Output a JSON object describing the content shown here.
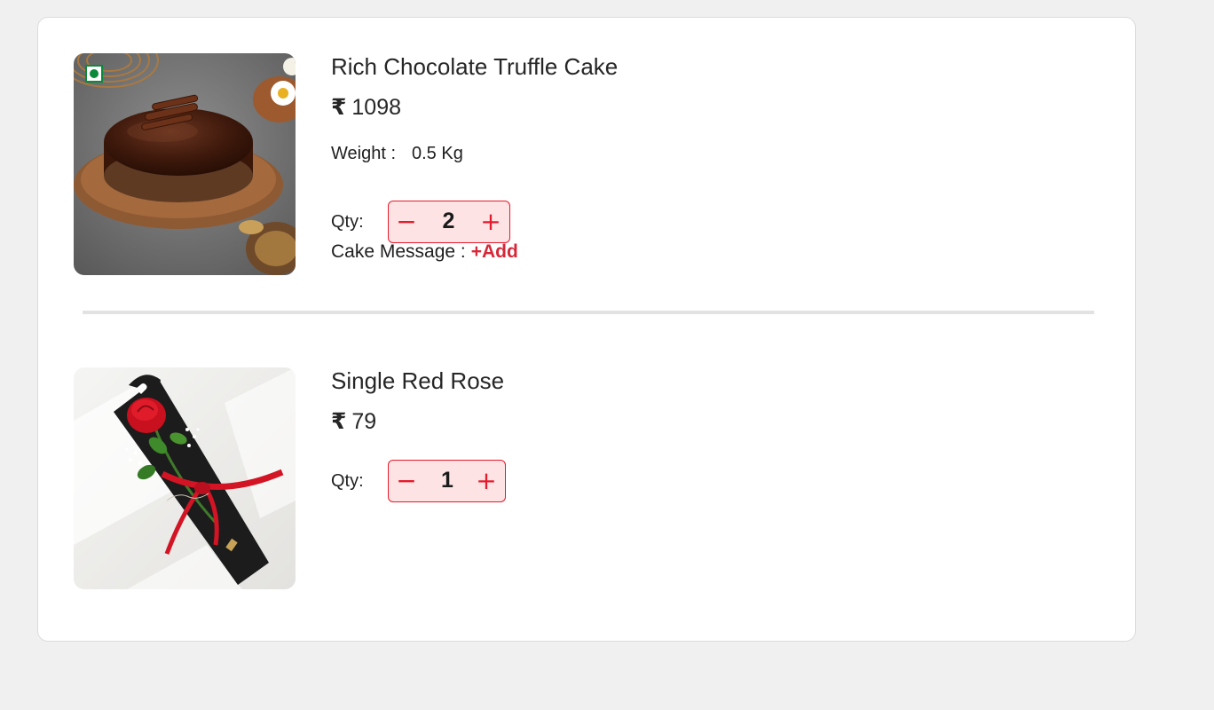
{
  "cart": {
    "items": [
      {
        "name": "Rich Chocolate Truffle Cake",
        "currency": "₹",
        "price": "1098",
        "weight_label": "Weight :",
        "weight_value": "0.5 Kg",
        "qty_label": "Qty:",
        "qty": "2",
        "minus": "−",
        "plus": "+",
        "message_label": "Cake Message :",
        "message_action": "+Add",
        "veg_indicator": "veg-mark-icon"
      },
      {
        "name": "Single Red Rose",
        "currency": "₹",
        "price": "79",
        "qty_label": "Qty:",
        "qty": "1",
        "minus": "−",
        "plus": "+"
      }
    ]
  },
  "colors": {
    "accent": "#e51a2c",
    "stepper_bg": "#fde3e4",
    "add_link": "#d62838",
    "veg_green": "#0a8a3a",
    "page_bg": "#f0f0f0"
  }
}
